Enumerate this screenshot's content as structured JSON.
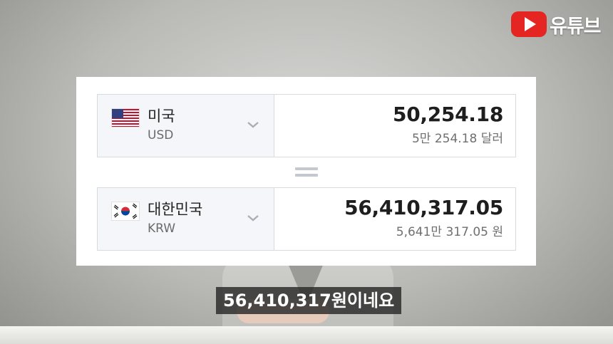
{
  "logo": {
    "text": "유튜브",
    "icon": "youtube-play-icon",
    "color": "#e52521"
  },
  "converter": {
    "from": {
      "country": "미국",
      "code": "USD",
      "flag": "us-flag-icon",
      "amount": "50,254.18",
      "amount_words": "5만 254.18 달러"
    },
    "to": {
      "country": "대한민국",
      "code": "KRW",
      "flag": "kr-flag-icon",
      "amount": "56,410,317.05",
      "amount_words": "5,641만 317.05 원"
    }
  },
  "subtitle": "56,410,317원이네요"
}
